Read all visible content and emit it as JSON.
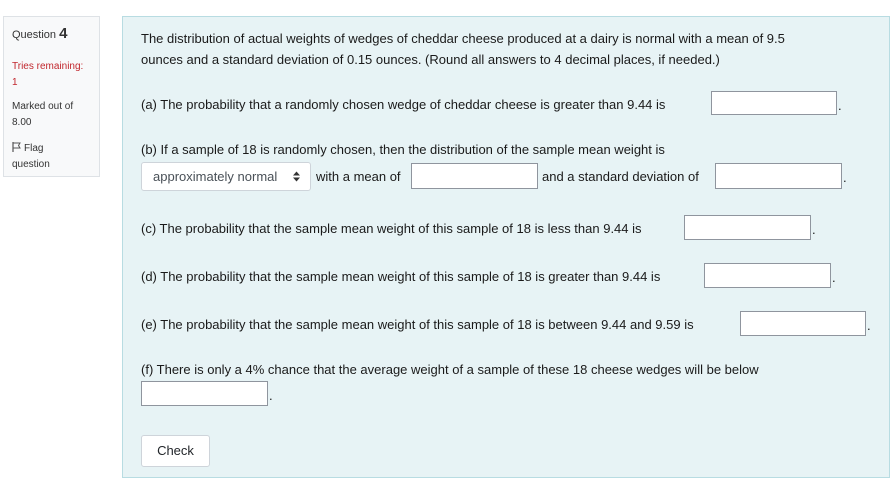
{
  "info": {
    "question_label": "Question",
    "question_number": "4",
    "tries_label": "Tries remaining:",
    "tries_value": "1",
    "marked_label": "Marked out of",
    "marked_value": "8.00",
    "flag_line1": "Flag",
    "flag_line2": "question",
    "flag_icon": "flag-icon"
  },
  "question": {
    "intro_line1": "The distribution of actual weights of wedges of cheddar cheese produced at a dairy is normal with a mean of 9.5",
    "intro_line2": "ounces and a standard deviation of 0.15 ounces. (Round all answers to 4 decimal places, if needed.)",
    "part_a": "(a) The probability that a randomly chosen wedge of cheddar cheese is greater than 9.44 is",
    "part_b": "(b) If a sample of 18 is randomly chosen, then the distribution of the sample mean weight is",
    "distribution_selected": "approximately normal",
    "with_mean_label": "with a mean of",
    "and_sd_label": "and a standard deviation of",
    "part_c": "(c) The probability that the sample mean weight of this sample of 18 is less than 9.44 is",
    "part_d": "(d) The probability that the sample mean weight of this sample of 18 is greater than 9.44 is",
    "part_e": "(e) The probability that the sample mean weight of this sample of 18 is between 9.44 and 9.59 is",
    "part_f": "(f) There is only a 4% chance that the average weight of a sample of these 18 cheese wedges will be below",
    "period": ".",
    "check_label": "Check"
  },
  "answers": {
    "a": "",
    "mean": "",
    "sd": "",
    "c": "",
    "d": "",
    "e": "",
    "f": ""
  },
  "colors": {
    "content_bg": "#e7f3f5",
    "info_bg": "#f8f9fa",
    "tries_text": "#c1272d"
  }
}
